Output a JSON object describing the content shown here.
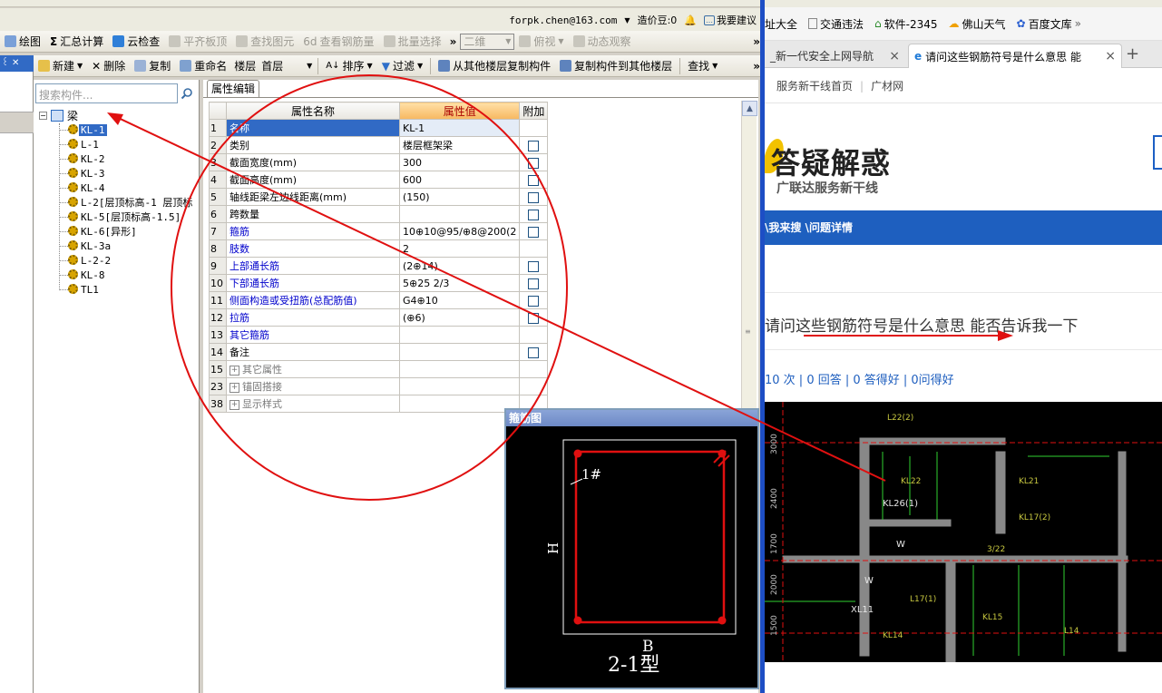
{
  "account": {
    "email": "forpk.chen@163.com",
    "cost_label": "造价豆:0",
    "suggest_label": "我要建议"
  },
  "toolbar1": {
    "items": [
      "绘图",
      "汇总计算",
      "云检查",
      "平齐板顶",
      "查找图元",
      "查看钢筋量",
      "批量选择"
    ],
    "view_combo": "二维",
    "items2": [
      "俯视",
      "动态观察"
    ]
  },
  "toolbar2": {
    "new": "新建",
    "delete": "删除",
    "copy": "复制",
    "rename": "重命名",
    "floor_label": "楼层",
    "floor_value": "首层",
    "sort": "排序",
    "filter": "过滤",
    "copy_from": "从其他楼层复制构件",
    "copy_to": "复制构件到其他楼层",
    "find": "查找"
  },
  "tree": {
    "search_placeholder": "搜索构件...",
    "root": "梁",
    "items": [
      "KL-1",
      "L-1",
      "KL-2",
      "KL-3",
      "KL-4",
      "L-2[层顶标高-1 层顶标",
      "KL-5[层顶标高-1.5]",
      "KL-6[异形]",
      "KL-3a",
      "L-2-2",
      "KL-8",
      "TL1"
    ],
    "selected": "KL-1"
  },
  "props": {
    "tab": "属性编辑",
    "headers": [
      "属性名称",
      "属性值",
      "附加"
    ],
    "rows": [
      {
        "n": "1",
        "name": "名称",
        "value": "KL-1",
        "check": false,
        "blue": true
      },
      {
        "n": "2",
        "name": "类别",
        "value": "楼层框架梁",
        "check": true,
        "blue": false
      },
      {
        "n": "3",
        "name": "截面宽度(mm)",
        "value": "300",
        "check": true,
        "blue": false
      },
      {
        "n": "4",
        "name": "截面高度(mm)",
        "value": "600",
        "check": true,
        "blue": false
      },
      {
        "n": "5",
        "name": "轴线距梁左边线距离(mm)",
        "value": "(150)",
        "check": true,
        "blue": false
      },
      {
        "n": "6",
        "name": "跨数量",
        "value": "",
        "check": true,
        "blue": false
      },
      {
        "n": "7",
        "name": "箍筋",
        "value": "10⊕10@95/⊕8@200(2",
        "check": true,
        "blue": true
      },
      {
        "n": "8",
        "name": "肢数",
        "value": "2",
        "check": false,
        "blue": true
      },
      {
        "n": "9",
        "name": "上部通长筋",
        "value": "(2⊕14)",
        "check": true,
        "blue": true
      },
      {
        "n": "10",
        "name": "下部通长筋",
        "value": "5⊕25 2/3",
        "check": true,
        "blue": true
      },
      {
        "n": "11",
        "name": "侧面构造或受扭筋(总配筋值)",
        "value": "G4⊕10",
        "check": true,
        "blue": true
      },
      {
        "n": "12",
        "name": "拉筋",
        "value": "(⊕6)",
        "check": true,
        "blue": true
      },
      {
        "n": "13",
        "name": "其它箍筋",
        "value": "",
        "check": false,
        "blue": true
      },
      {
        "n": "14",
        "name": "备注",
        "value": "",
        "check": true,
        "blue": false
      },
      {
        "n": "15",
        "name": "其它属性",
        "value": "",
        "check": false,
        "expand": true
      },
      {
        "n": "23",
        "name": "锚固搭接",
        "value": "",
        "check": false,
        "expand": true
      },
      {
        "n": "38",
        "name": "显示样式",
        "value": "",
        "check": false,
        "expand": true
      }
    ]
  },
  "stirrup": {
    "title": "箍筋图",
    "bar_label": "1#",
    "h_label": "H",
    "b_label": "B",
    "type_label": "2-1型"
  },
  "browser": {
    "favorites": [
      "址大全",
      "交通违法",
      "软件-2345",
      "佛山天气",
      "百度文库"
    ],
    "tabs": [
      "_新一代安全上网导航",
      "请问这些钢筋符号是什么意思 能"
    ],
    "subnav": [
      "服务新干线首页",
      "|",
      "广材网"
    ],
    "logo_title": "答疑解惑",
    "logo_sub": "广联达服务新干线",
    "breadcrumb": "\\我来搜 \\问题详情",
    "question": "请问这些钢筋符号是什么意思 能否告诉我一下",
    "stats": "10 次 | 0 回答 | 0 答得好 | 0问得好"
  },
  "colors": {
    "annotation": "#e01010",
    "selection": "#316ac5",
    "breadcrumb_bg": "#1e5fbf",
    "cad_bg": "#000000"
  }
}
